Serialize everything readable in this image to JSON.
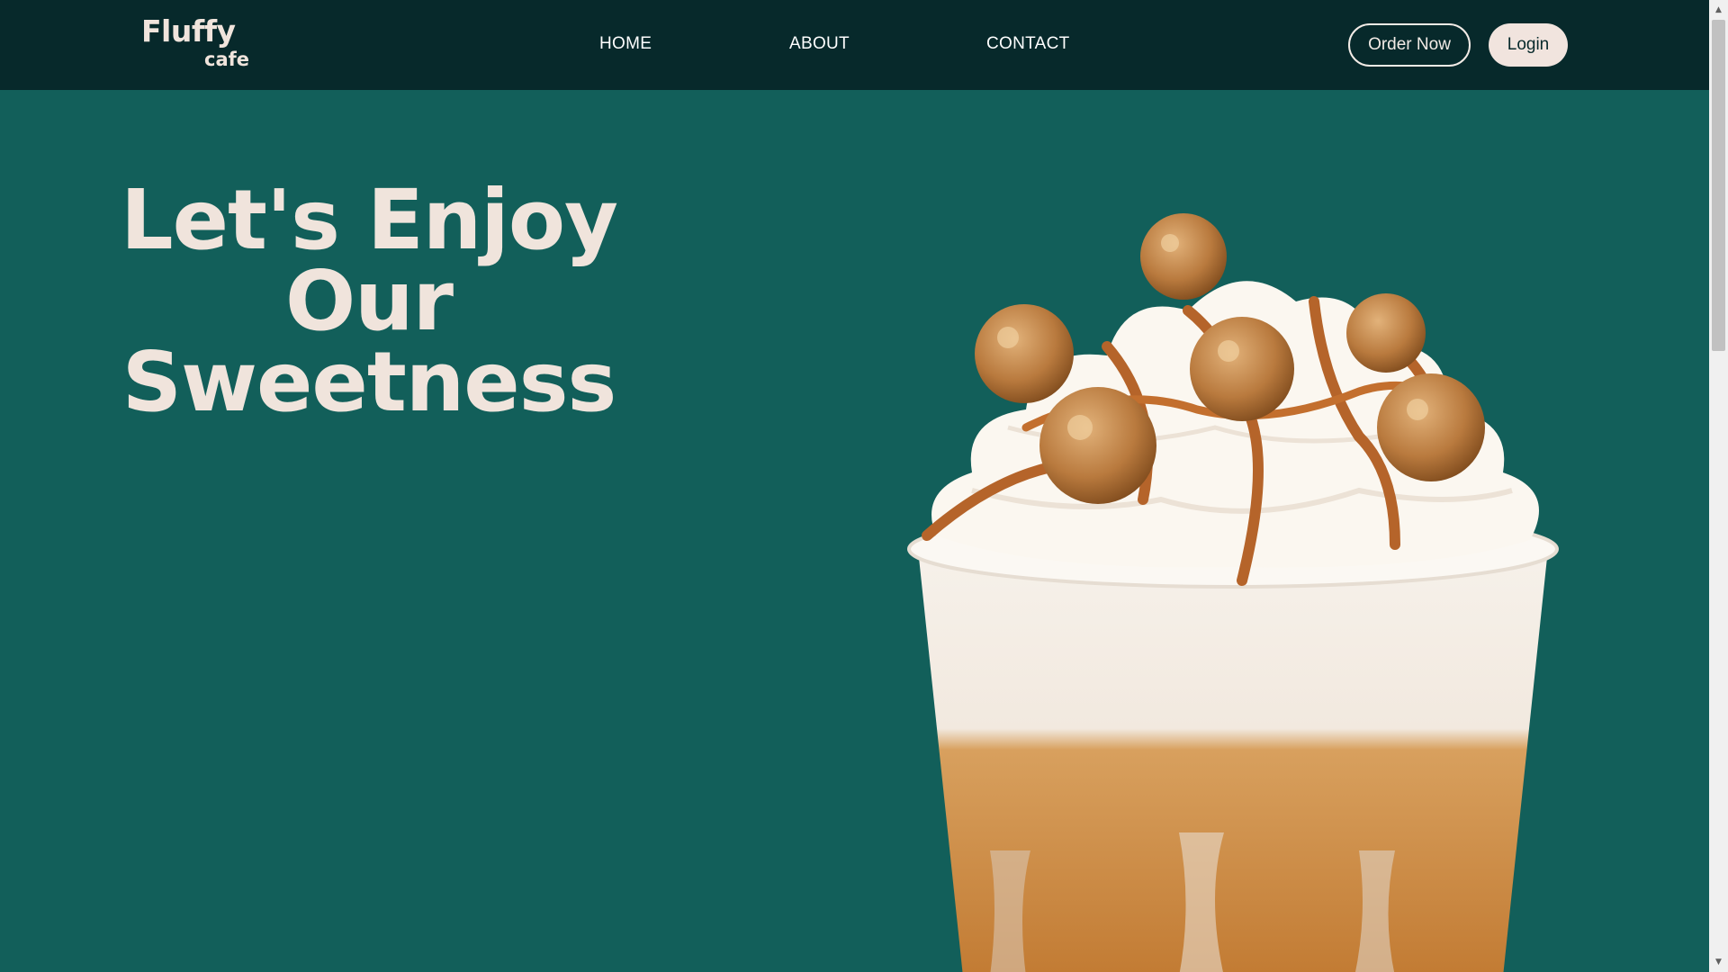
{
  "brand": {
    "name": "Fluffy",
    "sub": "cafe"
  },
  "nav": {
    "items": [
      {
        "label": "HOME"
      },
      {
        "label": "ABOUT"
      },
      {
        "label": "CONTACT"
      }
    ]
  },
  "actions": {
    "order_label": "Order Now",
    "login_label": "Login"
  },
  "hero": {
    "line1": "Let's Enjoy",
    "line2": "Our",
    "line3": "Sweetness"
  },
  "image": {
    "subject": "caramel-popcorn-frappe"
  },
  "colors": {
    "nav_bg": "#07292b",
    "hero_bg": "#125f5a",
    "cream": "#f0e4dc",
    "caramel": "#c07a35"
  },
  "scrollbar": {
    "up_icon": "chevron-up-icon",
    "down_icon": "chevron-down-icon"
  }
}
